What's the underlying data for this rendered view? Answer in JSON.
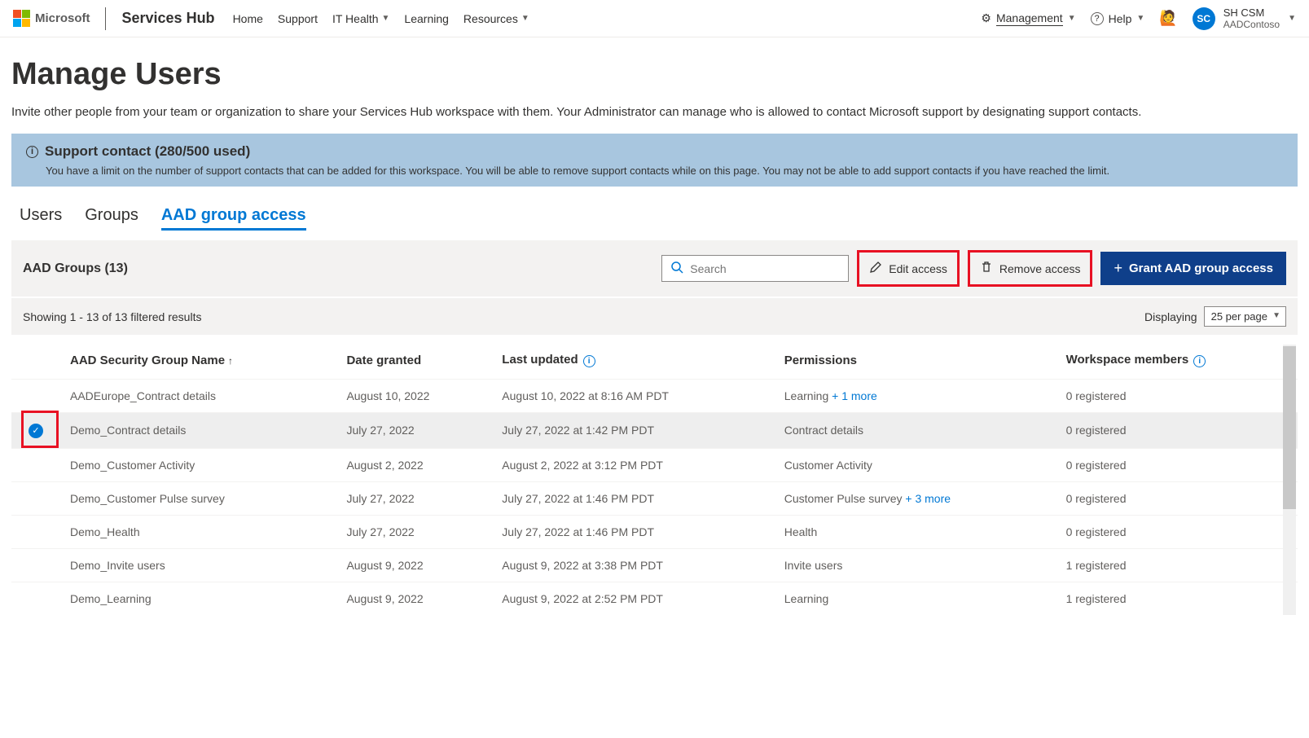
{
  "brand": {
    "company": "Microsoft",
    "app": "Services Hub"
  },
  "nav": {
    "home": "Home",
    "support": "Support",
    "itHealth": "IT Health",
    "learning": "Learning",
    "resources": "Resources"
  },
  "topRight": {
    "management": "Management",
    "help": "Help",
    "profile": {
      "initials": "SC",
      "name": "SH CSM",
      "tenant": "AADContoso"
    }
  },
  "page": {
    "title": "Manage Users",
    "desc": "Invite other people from your team or organization to share your Services Hub workspace with them. Your Administrator can manage who is allowed to contact Microsoft support by designating support contacts."
  },
  "infoBar": {
    "title": "Support contact (280/500 used)",
    "body": "You have a limit on the number of support contacts that can be added for this workspace. You will be able to remove support contacts while on this page. You may not be able to add support contacts if you have reached the limit."
  },
  "tabs": {
    "users": "Users",
    "groups": "Groups",
    "aad": "AAD group access"
  },
  "toolbar": {
    "title": "AAD Groups (13)",
    "searchPlaceholder": "Search",
    "edit": "Edit access",
    "remove": "Remove access",
    "grant": "Grant AAD group access"
  },
  "results": {
    "text": "Showing 1 - 13 of 13 filtered results",
    "displaying": "Displaying",
    "perPage": "25 per page"
  },
  "columns": {
    "name": "AAD Security Group Name",
    "granted": "Date granted",
    "updated": "Last updated",
    "perm": "Permissions",
    "members": "Workspace members"
  },
  "rows": [
    {
      "name": "AADEurope_Contract details",
      "granted": "August 10, 2022",
      "updated": "August 10, 2022 at 8:16 AM PDT",
      "perm": "Learning",
      "permMore": "+ 1 more",
      "members": "0 registered",
      "selected": false
    },
    {
      "name": "Demo_Contract details",
      "granted": "July 27, 2022",
      "updated": "July 27, 2022 at 1:42 PM PDT",
      "perm": "Contract details",
      "permMore": "",
      "members": "0 registered",
      "selected": true
    },
    {
      "name": "Demo_Customer Activity",
      "granted": "August 2, 2022",
      "updated": "August 2, 2022 at 3:12 PM PDT",
      "perm": "Customer Activity",
      "permMore": "",
      "members": "0 registered",
      "selected": false
    },
    {
      "name": "Demo_Customer Pulse survey",
      "granted": "July 27, 2022",
      "updated": "July 27, 2022 at 1:46 PM PDT",
      "perm": "Customer Pulse survey",
      "permMore": "+ 3 more",
      "members": "0 registered",
      "selected": false
    },
    {
      "name": "Demo_Health",
      "granted": "July 27, 2022",
      "updated": "July 27, 2022 at 1:46 PM PDT",
      "perm": "Health",
      "permMore": "",
      "members": "0 registered",
      "selected": false
    },
    {
      "name": "Demo_Invite users",
      "granted": "August 9, 2022",
      "updated": "August 9, 2022 at 3:38 PM PDT",
      "perm": "Invite users",
      "permMore": "",
      "members": "1 registered",
      "selected": false
    },
    {
      "name": "Demo_Learning",
      "granted": "August 9, 2022",
      "updated": "August 9, 2022 at 2:52 PM PDT",
      "perm": "Learning",
      "permMore": "",
      "members": "1 registered",
      "selected": false
    }
  ]
}
